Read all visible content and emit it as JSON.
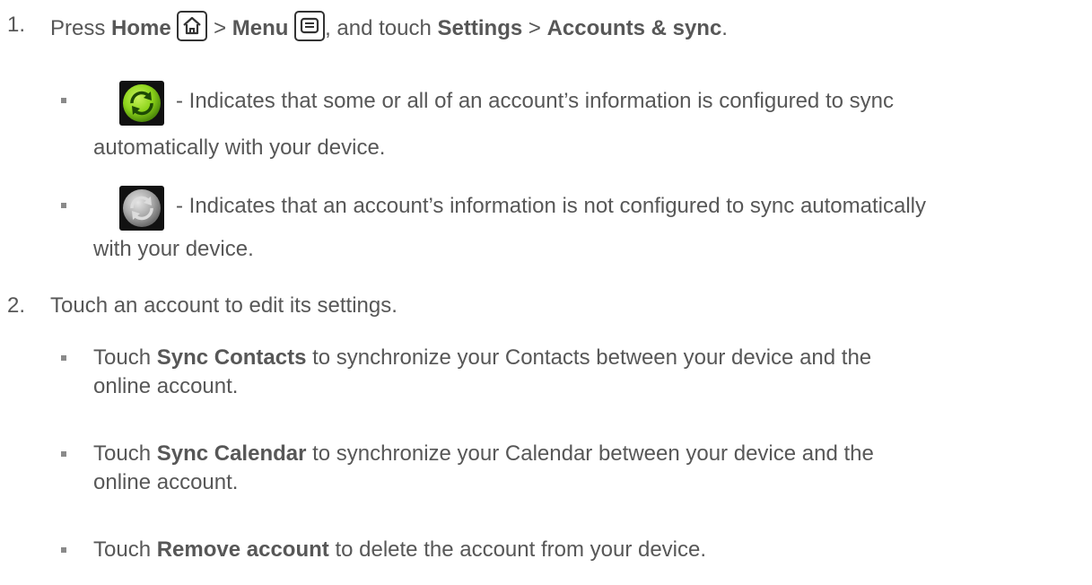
{
  "step1": {
    "num": "1.",
    "press": "Press",
    "home": "Home",
    "sep1": ">",
    "menu": "Menu",
    "and_touch": ", and touch",
    "settings": "Settings",
    "sep2": ">",
    "accounts": "Accounts & sync",
    "period": ".",
    "home_icon": "home-icon",
    "menu_icon": "menu-icon"
  },
  "sync_on": {
    "icon": "sync-green-icon",
    "line1": "- Indicates that some or all of an account’s information is configured to sync",
    "line2": "automatically with your device."
  },
  "sync_off": {
    "icon": "sync-gray-icon",
    "line1": "- Indicates that an account’s information is not configured to sync automatically",
    "line2": "with your device."
  },
  "step2": {
    "num": "2.",
    "text": "Touch an account to edit its settings."
  },
  "bullets": [
    {
      "pre": "Touch",
      "bold": "Sync Contacts",
      "post": "to synchronize your Contacts between your device and the",
      "line2": "online account."
    },
    {
      "pre": "Touch",
      "bold": "Sync Calendar",
      "post": "to synchronize your Calendar between your device and the",
      "line2": "online account."
    },
    {
      "pre": "Touch",
      "bold": "Remove account",
      "post": "to delete the account from your device."
    }
  ],
  "colors": {
    "text": "#575757",
    "sync_green": "#8cd31a",
    "sync_gray": "#9a9a9a"
  }
}
